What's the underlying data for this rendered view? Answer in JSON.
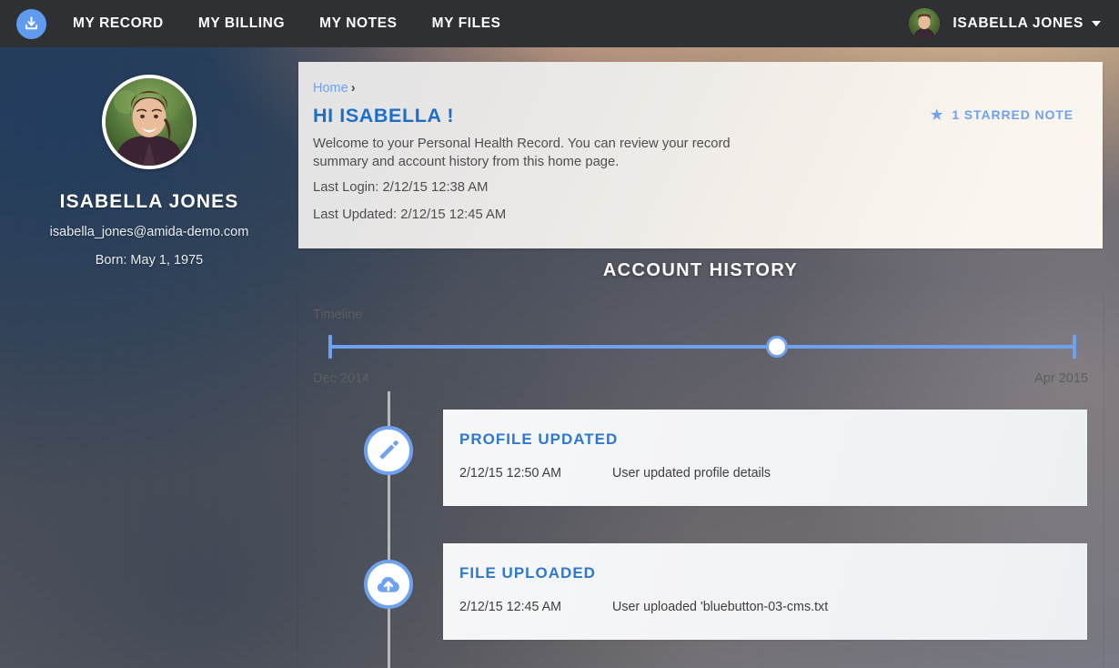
{
  "nav": {
    "logo_icon": "download-tray-icon",
    "links": [
      {
        "label": "MY RECORD"
      },
      {
        "label": "MY BILLING"
      },
      {
        "label": "MY NOTES"
      },
      {
        "label": "MY FILES"
      }
    ],
    "user": {
      "name": "ISABELLA JONES",
      "avatar_icon": "user-avatar-photo",
      "caret_icon": "chevron-down-icon"
    },
    "background_color": "#2f3033",
    "accent_color": "#5f9bef"
  },
  "profile": {
    "avatar_icon": "user-avatar-photo",
    "name": "ISABELLA JONES",
    "email": "isabella_jones@amida-demo.com",
    "born": "Born: May 1, 1975"
  },
  "welcome": {
    "breadcrumb": {
      "home_label": "Home",
      "separator": "›"
    },
    "greeting": "HI ISABELLA !",
    "body": "Welcome to your Personal Health Record. You can review your record summary and account history from this home page.",
    "last_login": "Last Login: 2/12/15 12:38 AM",
    "last_updated": "Last Updated: 2/12/15 12:45 AM",
    "starred": {
      "icon": "star-icon",
      "label": "1 STARRED NOTE",
      "count": 1
    },
    "link_color": "#6ea2f0",
    "heading_color": "#1e6ec8"
  },
  "history": {
    "section_title": "ACCOUNT HISTORY",
    "timeline_label": "Timeline",
    "range_start": "Dec 2014",
    "range_end": "Apr 2015",
    "slider_position_percent": 60,
    "slider_color": "#6ea2f0",
    "events": [
      {
        "icon": "pencil-edit-icon",
        "title": "PROFILE UPDATED",
        "time": "2/12/15 12:50 AM",
        "description": "User updated profile details"
      },
      {
        "icon": "cloud-upload-icon",
        "title": "FILE UPLOADED",
        "time": "2/12/15 12:45 AM",
        "description": "User uploaded 'bluebutton-03-cms.txt"
      }
    ]
  }
}
